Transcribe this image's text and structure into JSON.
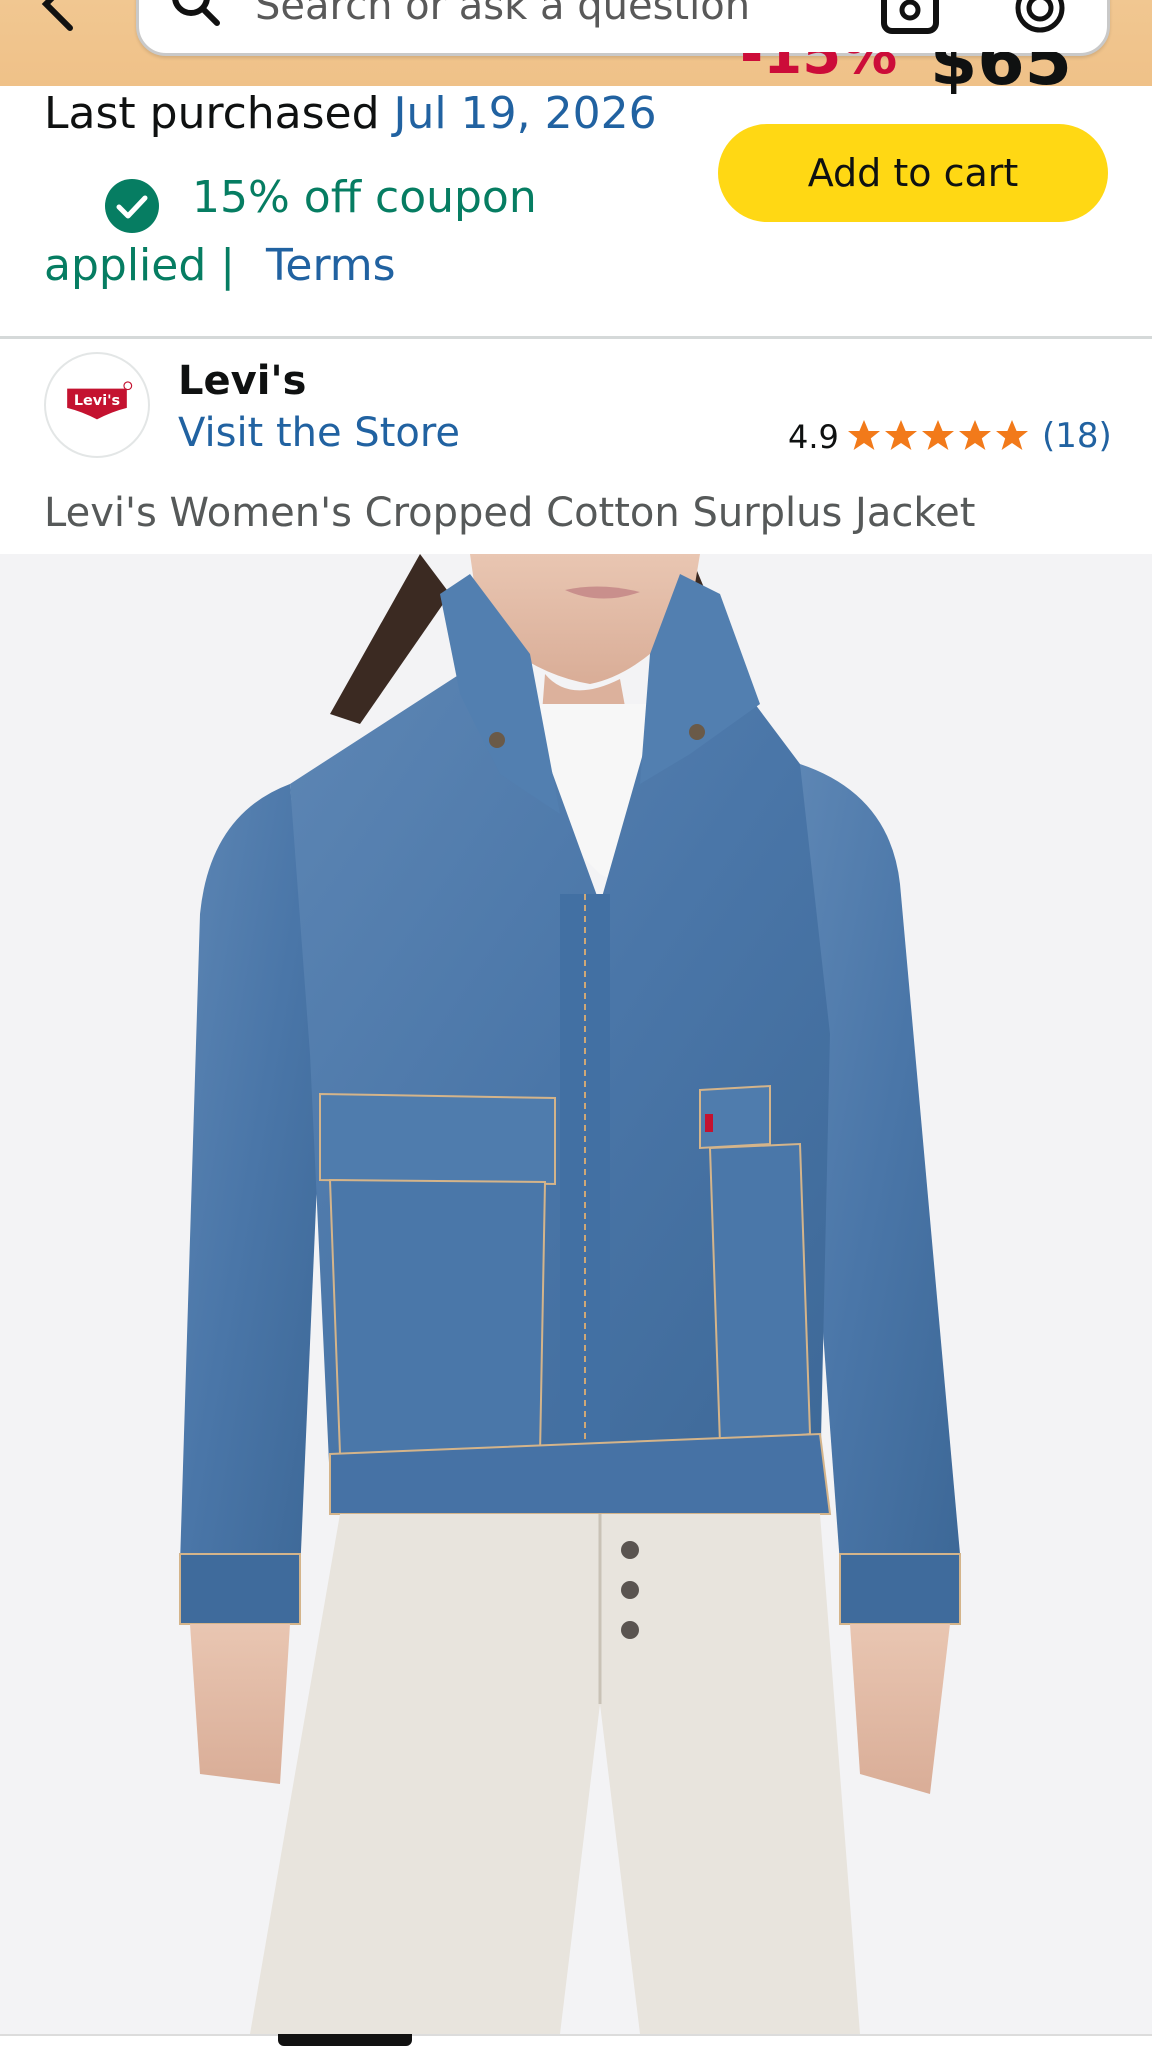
{
  "header": {
    "search_placeholder": "Search or ask a question",
    "back_icon": "back-arrow-icon",
    "search_icon": "search-icon",
    "camera_icon": "camera-icon",
    "mic_icon": "mic-icon"
  },
  "price": {
    "discount": "-15%",
    "amount": "$65"
  },
  "purchase": {
    "label": "Last purchased",
    "date": "Jul 19, 2026"
  },
  "cart": {
    "add_label": "Add to cart"
  },
  "coupon": {
    "line1": "15% off coupon",
    "line2": "applied |",
    "terms": "Terms"
  },
  "brand": {
    "logo_text": "Levi's",
    "name": "Levi's",
    "visit_store": "Visit the Store",
    "rating": "4.9",
    "rating_stars": 5,
    "rating_count": "(18)"
  },
  "product": {
    "title": "Levi's Women's Cropped Cotton Surplus Jacket"
  },
  "colors": {
    "header_bg": "#f1c791",
    "cart_button": "#ffd814",
    "link": "#2162a1",
    "coupon_green": "#067d62",
    "discount_red": "#cc0c39",
    "star": "#f27a1a"
  }
}
